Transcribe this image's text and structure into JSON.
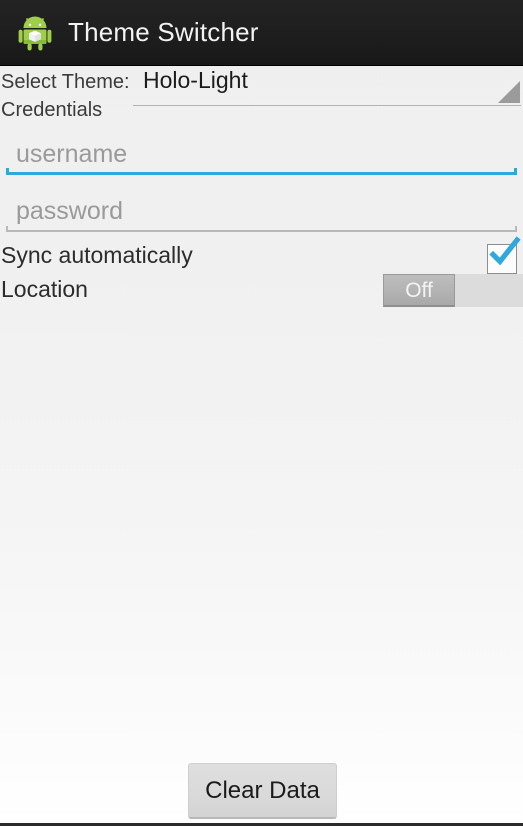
{
  "action_bar": {
    "title": "Theme Switcher",
    "icon": "android-robot-icon",
    "background_color": "#1e1e1e",
    "title_color": "#f2f2f2"
  },
  "form": {
    "select_theme_label": "Select Theme:",
    "theme_spinner": {
      "selected_value": "Holo-Light",
      "caret_icon": "dropdown-triangle-icon"
    },
    "credentials_label": "Credentials",
    "username": {
      "value": "",
      "placeholder": "username",
      "focused": true,
      "underline_color": "#2fa8dd"
    },
    "password": {
      "value": "",
      "placeholder": "password",
      "focused": false,
      "underline_color": "#b9b9b9"
    },
    "sync": {
      "label": "Sync automatically",
      "checked": true,
      "check_color": "#2fa8dd"
    },
    "location": {
      "label": "Location",
      "state_label": "Off",
      "checked": false
    }
  },
  "footer": {
    "clear_data_label": "Clear Data"
  }
}
